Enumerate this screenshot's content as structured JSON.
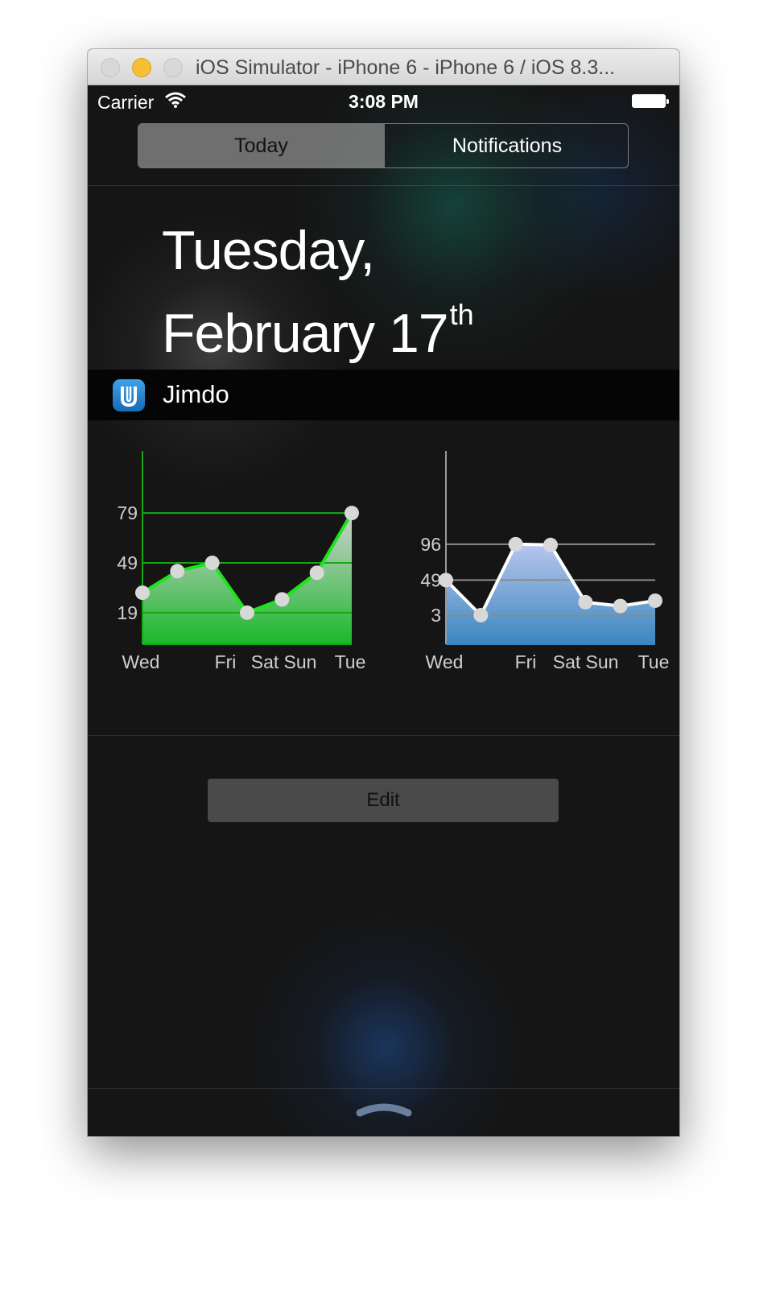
{
  "window": {
    "title": "iOS Simulator - iPhone 6 - iPhone 6 / iOS 8.3..."
  },
  "status_bar": {
    "carrier": "Carrier",
    "time": "3:08 PM"
  },
  "segmented_control": {
    "today": "Today",
    "notifications": "Notifications",
    "selected": "Today"
  },
  "date": {
    "line1": "Tuesday,",
    "line2": "February 17",
    "suffix": "th"
  },
  "widget": {
    "app_name": "Jimdo",
    "edit_label": "Edit"
  },
  "colors": {
    "green_line": "#1de51d",
    "blue_fill": "#4a8fc8",
    "background": "#151515"
  },
  "chart_data": [
    {
      "type": "area",
      "color": "#1de51d",
      "x_labels": [
        "Wed",
        "Fri",
        "Sat",
        "Sun",
        "Tue"
      ],
      "y_ticks": [
        "79",
        "49",
        "19"
      ],
      "values": [
        31,
        44,
        49,
        19,
        27,
        43,
        79
      ],
      "ylim": [
        0,
        97
      ],
      "grid": true
    },
    {
      "type": "area",
      "color": "#4a8fc8",
      "x_labels": [
        "Wed",
        "Fri",
        "Sat",
        "Sun",
        "Tue"
      ],
      "y_ticks": [
        "96",
        "49",
        "3"
      ],
      "values": [
        49,
        3,
        96,
        95,
        20,
        15,
        22
      ],
      "ylim": [
        -35,
        176
      ],
      "grid": true
    }
  ]
}
